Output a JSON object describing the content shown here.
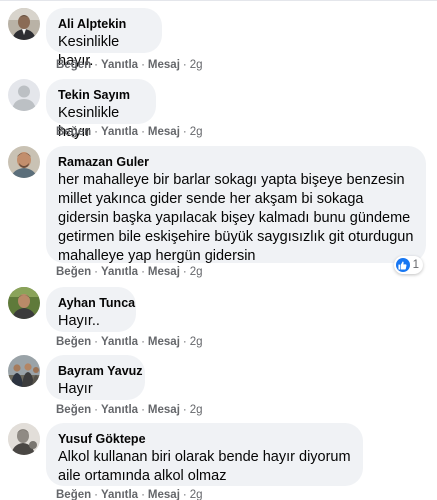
{
  "actions": {
    "like": "Beğen",
    "reply": "Yanıtla",
    "message": "Mesaj",
    "separator": "·"
  },
  "comments": [
    {
      "author": "Ali Alptekin",
      "text": "Kesinlikle hayır.",
      "time": "2g",
      "avatar": "person-photo"
    },
    {
      "author": "Tekin Sayım",
      "text": "Kesinlikle hayır",
      "time": "2g",
      "avatar": "default-avatar"
    },
    {
      "author": "Ramazan Guler",
      "text": "her mahalleye bir barlar sokagı yapta bişeye benzesin millet yakınca gider sende her akşam bi sokaga gidersin başka yapılacak bişey kalmadı bunu gündeme getirmen bile eskişehire büyük saygısızlık git oturdugun mahalleye yap hergün gidersin",
      "time": "2g",
      "avatar": "person-photo",
      "reaction": {
        "icon": "like-icon",
        "count": "1",
        "color": "#1877f2"
      }
    },
    {
      "author": "Ayhan Tunca",
      "text": "Hayır..",
      "time": "2g",
      "avatar": "person-photo"
    },
    {
      "author": "Bayram Yavuz",
      "text": "Hayır",
      "time": "2g",
      "avatar": "group-photo"
    },
    {
      "author": "Yusuf Göktepe",
      "text": "Alkol kullanan biri olarak bende hayır diyorum aile ortamında alkol olmaz",
      "time": "2g",
      "avatar": "person-photo"
    }
  ],
  "colors": {
    "bubble": "#f0f2f5",
    "text": "#050505",
    "meta": "#65676b",
    "like": "#1877f2"
  }
}
